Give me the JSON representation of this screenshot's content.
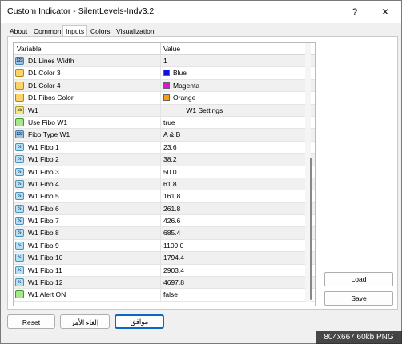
{
  "window": {
    "title": "Custom Indicator - SilentLevels-Indv3.2",
    "help_label": "?",
    "close_label": "✕"
  },
  "tabs": [
    "About",
    "Common",
    "Inputs",
    "Colors",
    "Visualization"
  ],
  "active_tab": "Inputs",
  "table": {
    "columns": [
      "Variable",
      "Value"
    ],
    "rows": [
      {
        "type": "int",
        "icon": "integer-icon",
        "badge": "123",
        "name": "D1 Lines Width",
        "value": "1"
      },
      {
        "type": "color",
        "icon": "color-icon",
        "badge": "",
        "name": "D1 Color 3",
        "value": "Blue",
        "swatch": "#1010e0"
      },
      {
        "type": "color",
        "icon": "color-icon",
        "badge": "",
        "name": "D1 Color 4",
        "value": "Magenta",
        "swatch": "#e010e0"
      },
      {
        "type": "color",
        "icon": "color-icon",
        "badge": "",
        "name": "D1 Fibos Color",
        "value": "Orange",
        "swatch": "#ff9f10"
      },
      {
        "type": "str",
        "icon": "string-icon",
        "badge": "ab",
        "name": "W1",
        "value": "______W1 Settings______"
      },
      {
        "type": "bool",
        "icon": "boolean-icon",
        "badge": "",
        "name": "Use Fibo W1",
        "value": "true"
      },
      {
        "type": "int",
        "icon": "integer-icon",
        "badge": "123",
        "name": "Fibo Type W1",
        "value": "A & B"
      },
      {
        "type": "dbl",
        "icon": "double-icon",
        "badge": "½",
        "name": "W1 Fibo 1",
        "value": "23.6"
      },
      {
        "type": "dbl",
        "icon": "double-icon",
        "badge": "½",
        "name": "W1 Fibo 2",
        "value": "38.2"
      },
      {
        "type": "dbl",
        "icon": "double-icon",
        "badge": "½",
        "name": "W1 Fibo 3",
        "value": "50.0"
      },
      {
        "type": "dbl",
        "icon": "double-icon",
        "badge": "½",
        "name": "W1 Fibo 4",
        "value": "61.8"
      },
      {
        "type": "dbl",
        "icon": "double-icon",
        "badge": "½",
        "name": "W1 Fibo 5",
        "value": "161.8"
      },
      {
        "type": "dbl",
        "icon": "double-icon",
        "badge": "½",
        "name": "W1 Fibo 6",
        "value": "261.8"
      },
      {
        "type": "dbl",
        "icon": "double-icon",
        "badge": "½",
        "name": "W1 Fibo 7",
        "value": "426.6"
      },
      {
        "type": "dbl",
        "icon": "double-icon",
        "badge": "½",
        "name": "W1 Fibo 8",
        "value": "685.4"
      },
      {
        "type": "dbl",
        "icon": "double-icon",
        "badge": "½",
        "name": "W1 Fibo 9",
        "value": "1109.0"
      },
      {
        "type": "dbl",
        "icon": "double-icon",
        "badge": "½",
        "name": "W1 Fibo 10",
        "value": "1794.4"
      },
      {
        "type": "dbl",
        "icon": "double-icon",
        "badge": "½",
        "name": "W1 Fibo 11",
        "value": "2903.4"
      },
      {
        "type": "dbl",
        "icon": "double-icon",
        "badge": "½",
        "name": "W1 Fibo 12",
        "value": "4697.8"
      },
      {
        "type": "bool",
        "icon": "boolean-icon",
        "badge": "",
        "name": "W1 Alert ON",
        "value": "false"
      }
    ]
  },
  "side_buttons": {
    "load": "Load",
    "save": "Save"
  },
  "bottom_buttons": {
    "reset": "Reset",
    "cancel": "إلغاء الأمر",
    "ok": "موافق"
  },
  "overlay": "804x667  60kb  PNG"
}
